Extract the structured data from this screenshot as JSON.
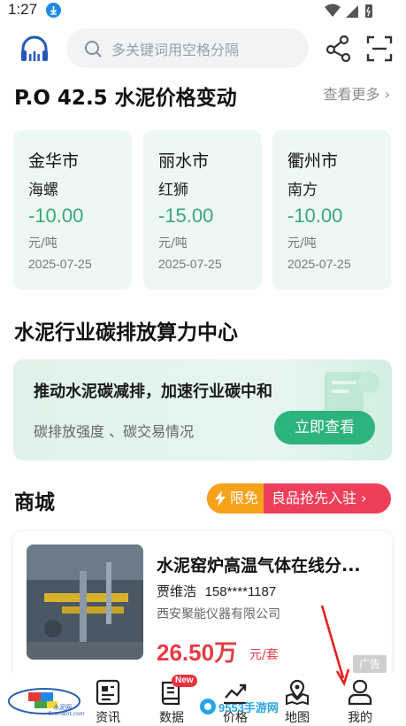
{
  "status_bar": {
    "time": "1:27"
  },
  "search": {
    "placeholder": "多关键词用空格分隔"
  },
  "price_section": {
    "title": "P.O 42.5 水泥价格变动",
    "see_more": "查看更多",
    "cards": [
      {
        "city": "金华市",
        "brand": "海螺",
        "change": "-10.00",
        "unit": "元/吨",
        "date": "2025-07-25"
      },
      {
        "city": "丽水市",
        "brand": "红狮",
        "change": "-15.00",
        "unit": "元/吨",
        "date": "2025-07-25"
      },
      {
        "city": "衢州市",
        "brand": "南方",
        "change": "-10.00",
        "unit": "元/吨",
        "date": "2025-07-25"
      }
    ]
  },
  "carbon_section": {
    "title": "水泥行业碳排放算力中心",
    "banner_heading": "推动水泥碳减排，加速行业碳中和",
    "banner_sub": "碳排放强度 、碳交易情况",
    "banner_button": "立即查看"
  },
  "mall_section": {
    "title": "商城",
    "free_label": "限免",
    "promo_label": "良品抢先入驻",
    "product": {
      "title": "水泥窑炉高温气体在线分...",
      "contact_name": "贾维浩",
      "contact_phone": "158****1187",
      "company": "西安聚能仪器有限公司",
      "price": "26.50万",
      "price_unit": "元/套",
      "ad_label": "广告"
    }
  },
  "bottom_nav": {
    "logo_text": "水泥网",
    "logo_sub": "Ccement.com",
    "items": [
      {
        "label": "资讯"
      },
      {
        "label": "数据",
        "badge": "New"
      },
      {
        "label": "价格"
      },
      {
        "label": "地图"
      },
      {
        "label": "我的"
      }
    ]
  },
  "watermark": "9553手游网",
  "colors": {
    "accent_green": "#2db37d",
    "price_green": "#3aa779",
    "price_red": "#e63b43",
    "promo_red": "#ee3f5a",
    "free_orange": "#f7a21b"
  }
}
